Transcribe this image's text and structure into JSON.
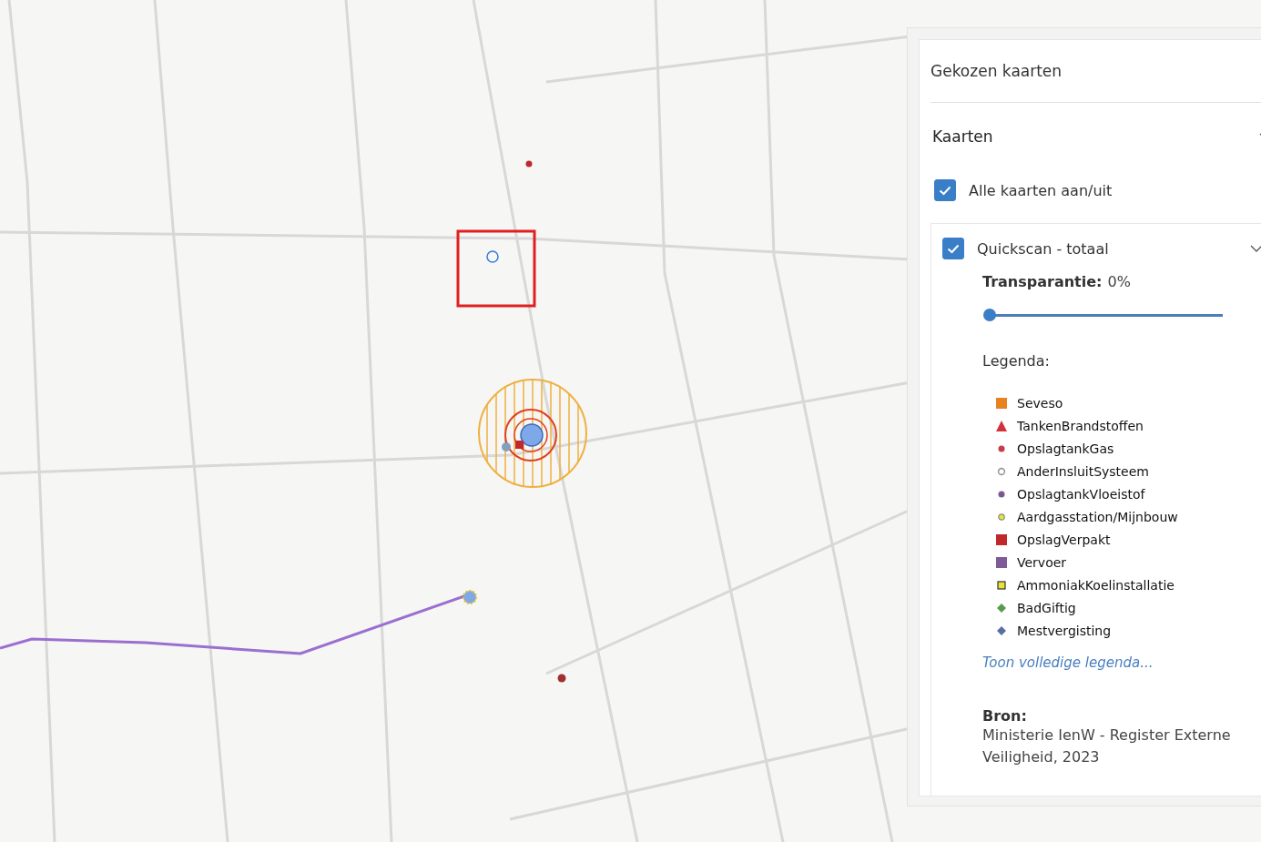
{
  "panel": {
    "title": "Gekozen kaarten",
    "section": {
      "title": "Kaarten",
      "expanded": true
    },
    "all_toggle": {
      "label": "Alle kaarten aan/uit",
      "checked": true
    },
    "layer": {
      "name": "Quickscan - totaal",
      "checked": true,
      "expanded": true,
      "transparency_label": "Transparantie:",
      "transparency_value": "0%",
      "level": 0,
      "legend_title": "Legenda:",
      "legend": [
        {
          "label": "Seveso",
          "kind": "square",
          "color": "#e8821e"
        },
        {
          "label": "TankenBrandstoffen",
          "kind": "triangle",
          "color": "#d2323c"
        },
        {
          "label": "OpslagtankGas",
          "kind": "dot",
          "color": "#c83c46"
        },
        {
          "label": "AnderInsluitSysteem",
          "kind": "ring",
          "color": "#9a9a9a"
        },
        {
          "label": "OpslagtankVloeistof",
          "kind": "dot",
          "color": "#7a5a8c"
        },
        {
          "label": "Aardgasstation/Mijnbouw",
          "kind": "rimmed-dot",
          "color": "#e6e632"
        },
        {
          "label": "OpslagVerpakt",
          "kind": "square",
          "color": "#c0282d"
        },
        {
          "label": "Vervoer",
          "kind": "square",
          "color": "#7e5a96"
        },
        {
          "label": "AmmoniakKoelinstallatie",
          "kind": "outline-square",
          "color": "#e6e632"
        },
        {
          "label": "BadGiftig",
          "kind": "diamond",
          "color": "#5a9a50"
        },
        {
          "label": "Mestvergisting",
          "kind": "diamond",
          "color": "#5a6ea0"
        }
      ],
      "legend_link": "Toon volledige legenda...",
      "source_title": "Bron:",
      "source_text": "Ministerie IenW - Register Externe Veiligheid, 2023"
    }
  }
}
